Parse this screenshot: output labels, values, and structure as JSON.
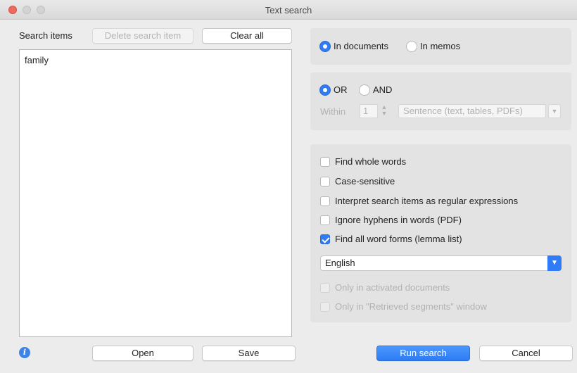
{
  "window": {
    "title": "Text search"
  },
  "search_items": {
    "label": "Search items",
    "delete_label": "Delete search item",
    "clear_label": "Clear all",
    "items": [
      "family"
    ]
  },
  "scope": {
    "in_documents": "In documents",
    "in_memos": "In memos",
    "selected": "In documents"
  },
  "logic": {
    "or": "OR",
    "and": "AND",
    "selected": "OR",
    "within_label": "Within",
    "within_value": "1",
    "unit": "Sentence (text, tables, PDFs)"
  },
  "options": {
    "whole_words": {
      "label": "Find whole words",
      "checked": false
    },
    "case_sensitive": {
      "label": "Case-sensitive",
      "checked": false
    },
    "regex": {
      "label": "Interpret search items as regular expressions",
      "checked": false
    },
    "hyphens": {
      "label": "Ignore hyphens in words (PDF)",
      "checked": false
    },
    "lemma": {
      "label": "Find all word forms (lemma list)",
      "checked": true
    },
    "language": "English",
    "activated": {
      "label": "Only in activated documents",
      "checked": false,
      "disabled": true
    },
    "retrieved": {
      "label": "Only in \"Retrieved segments\" window",
      "checked": false,
      "disabled": true
    }
  },
  "footer": {
    "info_glyph": "i",
    "open_label": "Open",
    "save_label": "Save",
    "run_label": "Run search",
    "cancel_label": "Cancel"
  },
  "colors": {
    "accent": "#2f7cf6",
    "close": "#ed6a5e"
  }
}
